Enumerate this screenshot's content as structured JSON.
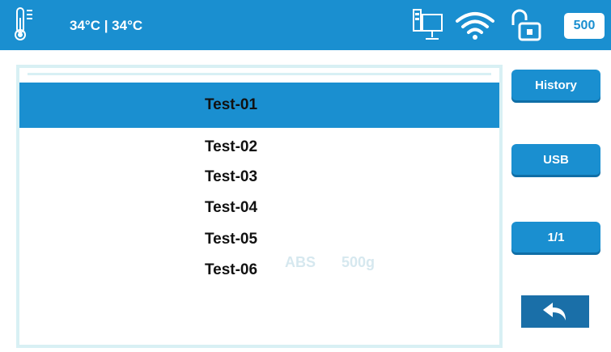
{
  "status_bar": {
    "temperature_text": "34°C | 34°C",
    "capacity_value": "500",
    "icons": [
      "thermometer-icon",
      "network-icon",
      "wifi-icon",
      "unlock-icon"
    ]
  },
  "file_list": {
    "items": [
      {
        "name": "Test-01",
        "selected": true
      },
      {
        "name": "Test-02",
        "selected": false
      },
      {
        "name": "Test-03",
        "selected": false
      },
      {
        "name": "Test-04",
        "selected": false
      },
      {
        "name": "Test-05",
        "selected": false
      },
      {
        "name": "Test-06",
        "selected": false
      }
    ],
    "ghost_material": "ABS",
    "ghost_weight": "500g"
  },
  "side_buttons": {
    "history": "History",
    "usb": "USB",
    "page": "1/1"
  },
  "colors": {
    "accent": "#1a8fd0",
    "panel_border": "#d8f0f4",
    "back_button": "#1a6fa8"
  }
}
